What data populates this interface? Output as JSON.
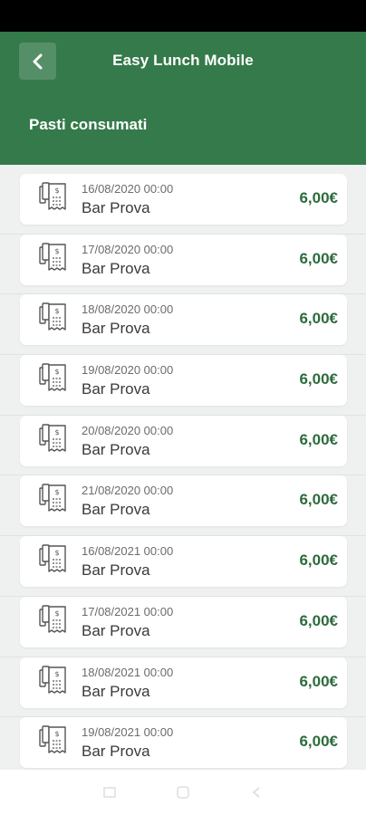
{
  "header": {
    "title": "Easy Lunch Mobile",
    "section": "Pasti consumati"
  },
  "colors": {
    "header_bg": "#357a4a",
    "amount": "#2d6b3c",
    "list_bg": "#eef1ef"
  },
  "meals": [
    {
      "date": "16/08/2020 00:00",
      "place": "Bar Prova",
      "amount": "6,00€"
    },
    {
      "date": "17/08/2020 00:00",
      "place": "Bar Prova",
      "amount": "6,00€"
    },
    {
      "date": "18/08/2020 00:00",
      "place": "Bar Prova",
      "amount": "6,00€"
    },
    {
      "date": "19/08/2020 00:00",
      "place": "Bar Prova",
      "amount": "6,00€"
    },
    {
      "date": "20/08/2020 00:00",
      "place": "Bar Prova",
      "amount": "6,00€"
    },
    {
      "date": "21/08/2020 00:00",
      "place": "Bar Prova",
      "amount": "6,00€"
    },
    {
      "date": "16/08/2021 00:00",
      "place": "Bar Prova",
      "amount": "6,00€"
    },
    {
      "date": "17/08/2021 00:00",
      "place": "Bar Prova",
      "amount": "6,00€"
    },
    {
      "date": "18/08/2021 00:00",
      "place": "Bar Prova",
      "amount": "6,00€"
    },
    {
      "date": "19/08/2021 00:00",
      "place": "Bar Prova",
      "amount": "6,00€"
    }
  ],
  "icons": {
    "back": "chevron-left-icon",
    "meal": "receipt-icon",
    "nav": [
      "recent-apps-icon",
      "home-icon",
      "back-nav-icon"
    ]
  }
}
